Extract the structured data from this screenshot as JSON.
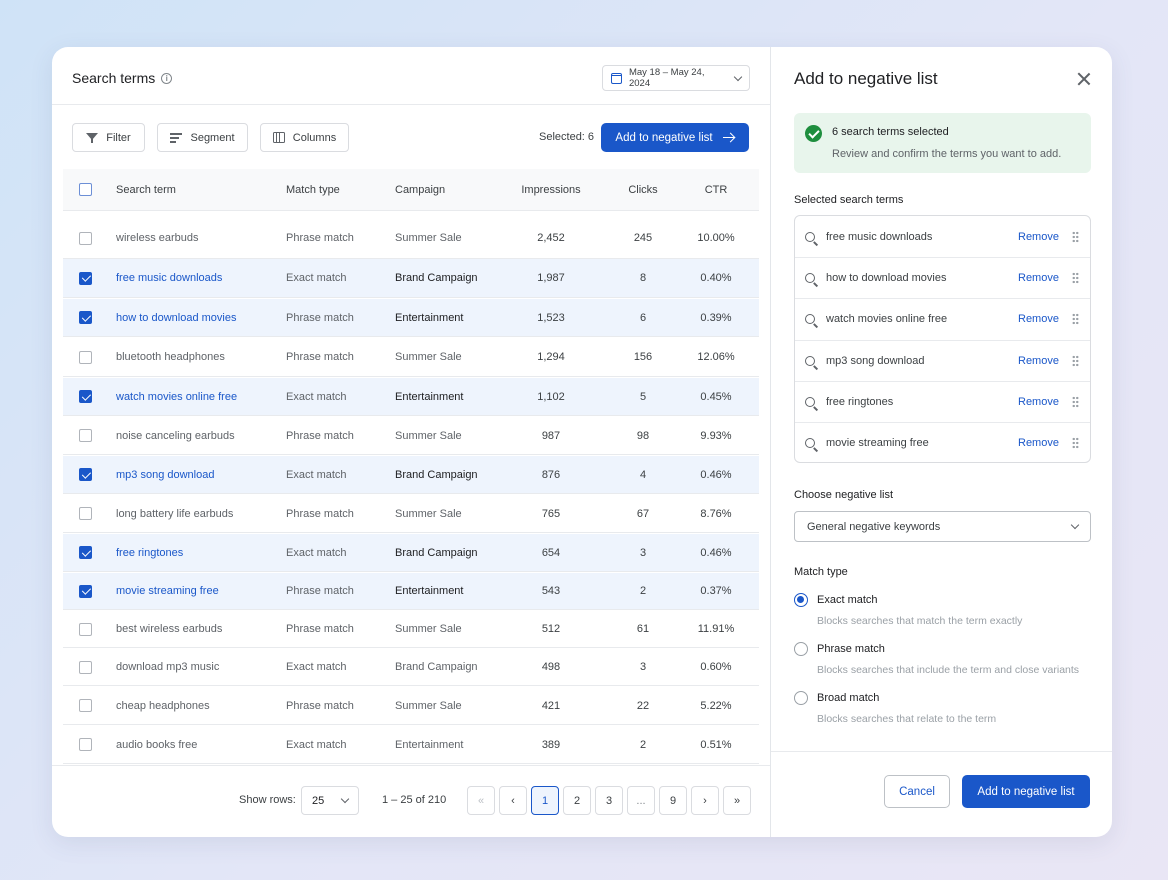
{
  "header": {
    "title": "Search terms",
    "date_range": "May 18 – May 24, 2024"
  },
  "toolbar": {
    "filter": "Filter",
    "segment": "Segment",
    "columns": "Columns",
    "selected": "Selected: 6",
    "add_button": "Add to negative list"
  },
  "table": {
    "columns": [
      "Search term",
      "Match type",
      "Campaign",
      "Impressions",
      "Clicks",
      "CTR"
    ],
    "rows": [
      {
        "term": "wireless earbuds",
        "match": "Phrase match",
        "campaign": "Summer Sale",
        "impressions": "2,452",
        "clicks": "245",
        "ctr": "10.00%",
        "selected": false
      },
      {
        "term": "free music downloads",
        "match": "Exact match",
        "campaign": "Brand Campaign",
        "impressions": "1,987",
        "clicks": "8",
        "ctr": "0.40%",
        "selected": true
      },
      {
        "term": "how to download movies",
        "match": "Phrase match",
        "campaign": "Entertainment",
        "impressions": "1,523",
        "clicks": "6",
        "ctr": "0.39%",
        "selected": true
      },
      {
        "term": "bluetooth headphones",
        "match": "Phrase match",
        "campaign": "Summer Sale",
        "impressions": "1,294",
        "clicks": "156",
        "ctr": "12.06%",
        "selected": false
      },
      {
        "term": "watch movies online free",
        "match": "Exact match",
        "campaign": "Entertainment",
        "impressions": "1,102",
        "clicks": "5",
        "ctr": "0.45%",
        "selected": true
      },
      {
        "term": "noise canceling earbuds",
        "match": "Phrase match",
        "campaign": "Summer Sale",
        "impressions": "987",
        "clicks": "98",
        "ctr": "9.93%",
        "selected": false
      },
      {
        "term": "mp3 song download",
        "match": "Exact match",
        "campaign": "Brand Campaign",
        "impressions": "876",
        "clicks": "4",
        "ctr": "0.46%",
        "selected": true
      },
      {
        "term": "long battery life earbuds",
        "match": "Phrase match",
        "campaign": "Summer Sale",
        "impressions": "765",
        "clicks": "67",
        "ctr": "8.76%",
        "selected": false
      },
      {
        "term": "free ringtones",
        "match": "Exact match",
        "campaign": "Brand Campaign",
        "impressions": "654",
        "clicks": "3",
        "ctr": "0.46%",
        "selected": true
      },
      {
        "term": "movie streaming free",
        "match": "Phrase match",
        "campaign": "Entertainment",
        "impressions": "543",
        "clicks": "2",
        "ctr": "0.37%",
        "selected": true
      },
      {
        "term": "best wireless earbuds",
        "match": "Phrase match",
        "campaign": "Summer Sale",
        "impressions": "512",
        "clicks": "61",
        "ctr": "11.91%",
        "selected": false
      },
      {
        "term": "download mp3 music",
        "match": "Exact match",
        "campaign": "Brand Campaign",
        "impressions": "498",
        "clicks": "3",
        "ctr": "0.60%",
        "selected": false
      },
      {
        "term": "cheap headphones",
        "match": "Phrase match",
        "campaign": "Summer Sale",
        "impressions": "421",
        "clicks": "22",
        "ctr": "5.22%",
        "selected": false
      },
      {
        "term": "audio books free",
        "match": "Exact match",
        "campaign": "Entertainment",
        "impressions": "389",
        "clicks": "2",
        "ctr": "0.51%",
        "selected": false
      }
    ]
  },
  "pagination": {
    "show_rows_label": "Show rows:",
    "rows_value": "25",
    "range": "1 – 25 of 210",
    "pages": [
      "1",
      "2",
      "3",
      "...",
      "9"
    ],
    "first": "«",
    "prev": "‹",
    "next": "›",
    "last": "»",
    "current": "1"
  },
  "panel": {
    "title": "Add to negative list",
    "alert_title": "6 search terms selected",
    "alert_sub": "Review and confirm the terms you want to add.",
    "selected_heading": "Selected search terms",
    "remove_label": "Remove",
    "terms": [
      "free music downloads",
      "how to download movies",
      "watch movies online free",
      "mp3 song download",
      "free ringtones",
      "movie streaming free"
    ],
    "list_heading": "Choose negative list",
    "list_value": "General negative keywords",
    "match_heading": "Match type",
    "match_options": [
      {
        "label": "Exact match",
        "desc": "Blocks searches that match the term exactly",
        "selected": true
      },
      {
        "label": "Phrase match",
        "desc": "Blocks searches that include the term and close variants",
        "selected": false
      },
      {
        "label": "Broad match",
        "desc": "Blocks searches that relate to the term",
        "selected": false
      }
    ],
    "cancel": "Cancel",
    "confirm": "Add to negative list"
  },
  "colors": {
    "primary": "#1a57c9",
    "selected_row": "#eef4fd",
    "success": "#1e8e3e"
  }
}
